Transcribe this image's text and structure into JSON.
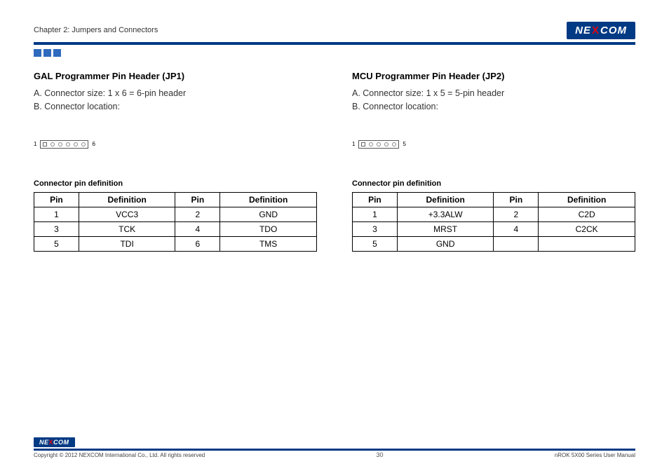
{
  "header": {
    "chapter": "Chapter 2: Jumpers and Connectors",
    "logo_prefix": "NE",
    "logo_x": "X",
    "logo_suffix": "COM"
  },
  "left": {
    "heading": "GAL Programmer Pin Header (JP1)",
    "line_a": "A. Connector size: 1 x 6 = 6-pin header",
    "line_b": "B. Connector location:",
    "conn_start": "1",
    "conn_end": "6",
    "pins": 6,
    "subhead": "Connector pin definition",
    "table": {
      "cols": [
        "Pin",
        "Definition",
        "Pin",
        "Definition"
      ],
      "rows": [
        [
          "1",
          "VCC3",
          "2",
          "GND"
        ],
        [
          "3",
          "TCK",
          "4",
          "TDO"
        ],
        [
          "5",
          "TDI",
          "6",
          "TMS"
        ]
      ]
    }
  },
  "right": {
    "heading": "MCU Programmer Pin Header (JP2)",
    "line_a": "A. Connector size: 1 x 5 = 5-pin header",
    "line_b": "B. Connector location:",
    "conn_start": "1",
    "conn_end": "5",
    "pins": 5,
    "subhead": "Connector pin definition",
    "table": {
      "cols": [
        "Pin",
        "Definition",
        "Pin",
        "Definition"
      ],
      "rows": [
        [
          "1",
          "+3.3ALW",
          "2",
          "C2D"
        ],
        [
          "3",
          "MRST",
          "4",
          "C2CK"
        ],
        [
          "5",
          "GND",
          "",
          ""
        ]
      ]
    }
  },
  "footer": {
    "copyright": "Copyright © 2012 NEXCOM International Co., Ltd. All rights reserved",
    "page": "30",
    "manual": "nROK 5X00 Series User Manual"
  }
}
